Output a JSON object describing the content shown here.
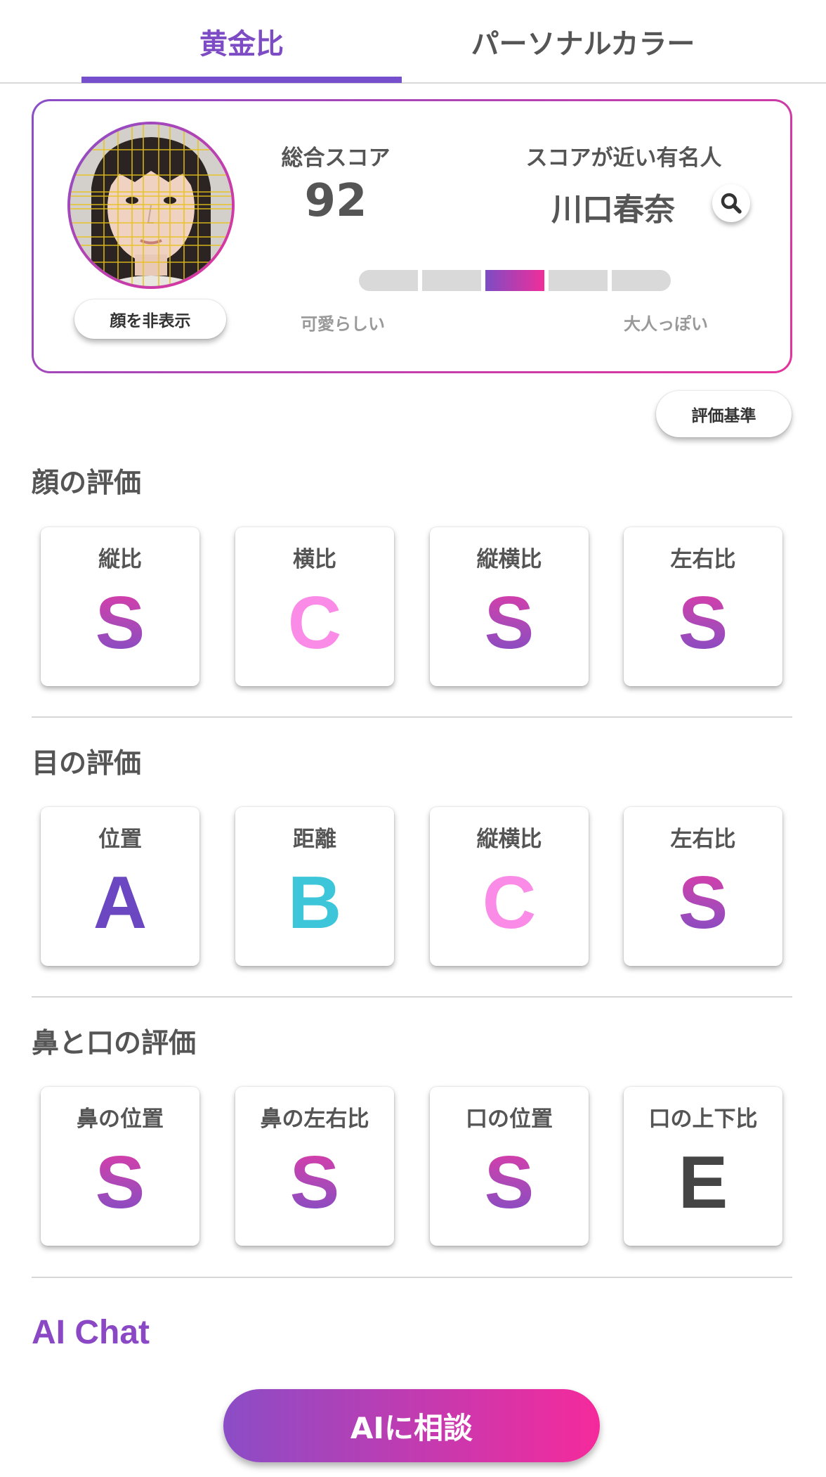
{
  "tabs": [
    {
      "label": "黄金比",
      "active": true
    },
    {
      "label": "パーソナルカラー",
      "active": false
    }
  ],
  "score_card": {
    "hide_face_label": "顔を非表示",
    "total_label": "総合スコア",
    "total_value": "92",
    "celeb_label": "スコアが近い有名人",
    "celeb_name": "川口春奈",
    "meter": {
      "segments": 5,
      "active_index": 2
    },
    "meter_left": "可愛らしい",
    "meter_right": "大人っぽい"
  },
  "criteria_label": "評価基準",
  "sections": [
    {
      "title": "顔の評価",
      "items": [
        {
          "label": "縦比",
          "grade": "S"
        },
        {
          "label": "横比",
          "grade": "C"
        },
        {
          "label": "縦横比",
          "grade": "S"
        },
        {
          "label": "左右比",
          "grade": "S"
        }
      ]
    },
    {
      "title": "目の評価",
      "items": [
        {
          "label": "位置",
          "grade": "A"
        },
        {
          "label": "距離",
          "grade": "B"
        },
        {
          "label": "縦横比",
          "grade": "C"
        },
        {
          "label": "左右比",
          "grade": "S"
        }
      ]
    },
    {
      "title": "鼻と口の評価",
      "items": [
        {
          "label": "鼻の位置",
          "grade": "S"
        },
        {
          "label": "鼻の左右比",
          "grade": "S"
        },
        {
          "label": "口の位置",
          "grade": "S"
        },
        {
          "label": "口の上下比",
          "grade": "E"
        }
      ]
    }
  ],
  "ai_chat": {
    "title": "AI Chat",
    "button_label": "AIに相談"
  },
  "colors": {
    "accent_purple": "#7650cc",
    "accent_pink": "#f02e9a",
    "grade_C": "#fa8ce8",
    "grade_A": "#6b47c2",
    "grade_B": "#3dc6d9",
    "grade_E": "#454545"
  }
}
